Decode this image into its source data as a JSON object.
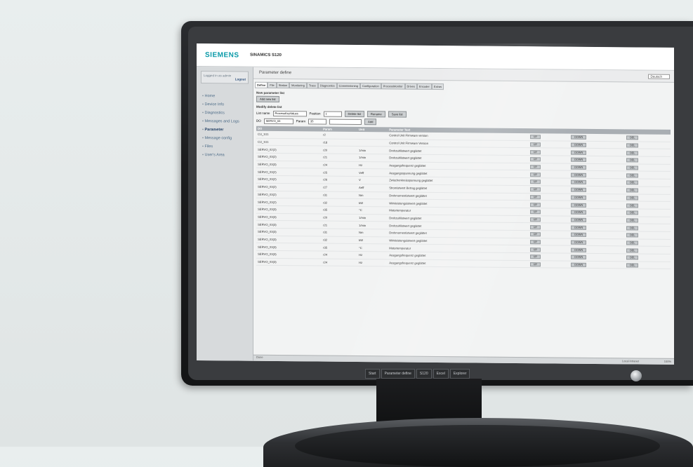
{
  "brand": {
    "logo": "SIEMENS",
    "product": "SINAMICS S120"
  },
  "login": {
    "user": "Logged in as admin",
    "button": "Logout"
  },
  "page_title": "Parameter define",
  "language": "Deutsch",
  "sidebar": {
    "items": [
      {
        "label": "Home"
      },
      {
        "label": "Device Info"
      },
      {
        "label": "Diagnostics"
      },
      {
        "label": "Messages and Logs"
      },
      {
        "label": "Parameter"
      },
      {
        "label": "Message config"
      },
      {
        "label": "Files"
      },
      {
        "label": "User's Area"
      }
    ]
  },
  "tabs": [
    "Define",
    "File",
    "Station",
    "Monitoring",
    "Trace",
    "Diagnostics",
    "Commissioning",
    "Configuration",
    "ProcessMonitor",
    "Drives",
    "Encoder",
    "Extras"
  ],
  "new_list": {
    "heading": "New parameter list",
    "add_button": "Add new list"
  },
  "modify": {
    "heading": "Modify delete list",
    "list_label": "List name",
    "list_value": "ProcessKeyValues",
    "position_label": "Position",
    "position_value": "1",
    "delete_button": "Delete list",
    "rename_button": "Rename",
    "save_button": "Save list"
  },
  "add_row": {
    "do_label": "DO",
    "do_value": "SERVO_03",
    "param_label": "Param",
    "param_value": "35",
    "add_button": "Add"
  },
  "table": {
    "columns": [
      "DO",
      "Param",
      "Unit",
      "Parameter Text",
      "",
      "",
      ""
    ],
    "rows": [
      {
        "do": "CU_S11",
        "param": "r2",
        "unit": "",
        "text": "Control Unit Firmware version"
      },
      {
        "do": "CU_S11",
        "param": "r18",
        "unit": "",
        "text": "Control Unit Firmware Version"
      },
      {
        "do": "SERVO_02(2)",
        "param": "r20",
        "unit": "1/min",
        "text": "Drehzahlistwert geglättet"
      },
      {
        "do": "SERVO_03(2)",
        "param": "r21",
        "unit": "1/min",
        "text": "Drehzahlistwert geglättet"
      },
      {
        "do": "SERVO_03(3)",
        "param": "r24",
        "unit": "Hz",
        "text": "Ausgangsfrequenz geglättet"
      },
      {
        "do": "SERVO_03(2)",
        "param": "r25",
        "unit": "Veff",
        "text": "Ausgangsspannung geglättet"
      },
      {
        "do": "SERVO_03(2)",
        "param": "r26",
        "unit": "V",
        "text": "Zwischenkreisspannung geglättet"
      },
      {
        "do": "SERVO_03(2)",
        "param": "r27",
        "unit": "Aeff",
        "text": "Stromistwert Betrag geglättet"
      },
      {
        "do": "SERVO_03(2)",
        "param": "r31",
        "unit": "Nm",
        "text": "Drehmomentistwert geglättet"
      },
      {
        "do": "SERVO_03(2)",
        "param": "r32",
        "unit": "kW",
        "text": "Wirkleistungsistwert geglättet"
      },
      {
        "do": "SERVO_03(3)",
        "param": "r35",
        "unit": "°C",
        "text": "Motortemperatur"
      },
      {
        "do": "SERVO_03(3)",
        "param": "r20",
        "unit": "1/min",
        "text": "Drehzahlistwert geglättet"
      },
      {
        "do": "SERVO_03(3)",
        "param": "r21",
        "unit": "1/min",
        "text": "Drehzahlistwert geglättet"
      },
      {
        "do": "SERVO_03(3)",
        "param": "r31",
        "unit": "Nm",
        "text": "Drehmomentistwert geglättet"
      },
      {
        "do": "SERVO_03(3)",
        "param": "r32",
        "unit": "kW",
        "text": "Wirkleistungsistwert geglättet"
      },
      {
        "do": "SERVO_03(3)",
        "param": "r35",
        "unit": "°C",
        "text": "Motortemperatur"
      },
      {
        "do": "SERVO_03(3)",
        "param": "r24",
        "unit": "Hz",
        "text": "Ausgangsfrequenz geglättet"
      },
      {
        "do": "SERVO_03(3)",
        "param": "r24",
        "unit": "Hz",
        "text": "Ausgangsfrequenz geglättet"
      }
    ],
    "up": "UP",
    "down": "DOWN",
    "del": "DEL"
  },
  "status": {
    "left": "Done",
    "net": "Local intranet",
    "zoom": "100%"
  },
  "taskbar": [
    "Start",
    "Parameter define",
    "S120",
    "Excel",
    "Explorer"
  ]
}
